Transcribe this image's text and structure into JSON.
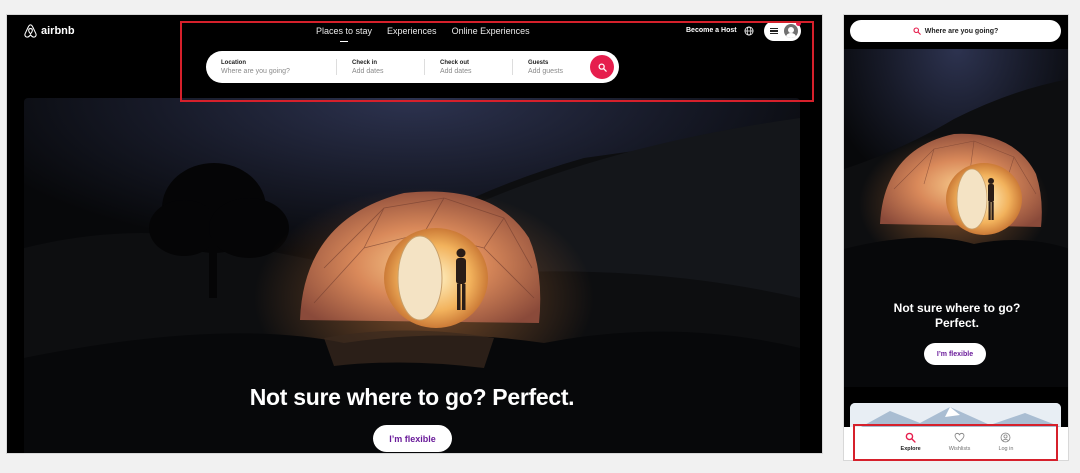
{
  "desktop": {
    "brand": {
      "name": "airbnb",
      "color": "#ff385c"
    },
    "nav": {
      "tabs": [
        {
          "label": "Places to stay",
          "active": true
        },
        {
          "label": "Experiences",
          "active": false
        },
        {
          "label": "Online Experiences",
          "active": false
        }
      ],
      "become_host": "Become a Host",
      "globe_icon": "globe-icon",
      "menu_icon": "hamburger-icon",
      "avatar_icon": "user-avatar-icon"
    },
    "search": {
      "location": {
        "label": "Location",
        "placeholder": "Where are you going?"
      },
      "check_in": {
        "label": "Check in",
        "placeholder": "Add dates"
      },
      "check_out": {
        "label": "Check out",
        "placeholder": "Add dates"
      },
      "guests": {
        "label": "Guests",
        "placeholder": "Add guests"
      },
      "button_icon": "search-icon",
      "button_color": "#e61e4d"
    },
    "hero": {
      "title": "Not sure where to go? Perfect.",
      "cta": "I’m flexible"
    }
  },
  "mobile": {
    "search_placeholder": "Where are you going?",
    "hero": {
      "title": "Not sure where to go? Perfect.",
      "cta": "I’m flexible"
    },
    "tabbar": [
      {
        "label": "Explore",
        "icon": "search-icon",
        "active": true
      },
      {
        "label": "Wishlists",
        "icon": "heart-icon",
        "active": false
      },
      {
        "label": "Log in",
        "icon": "user-circle-icon",
        "active": false
      }
    ]
  },
  "annotation_color": "#d6202b"
}
